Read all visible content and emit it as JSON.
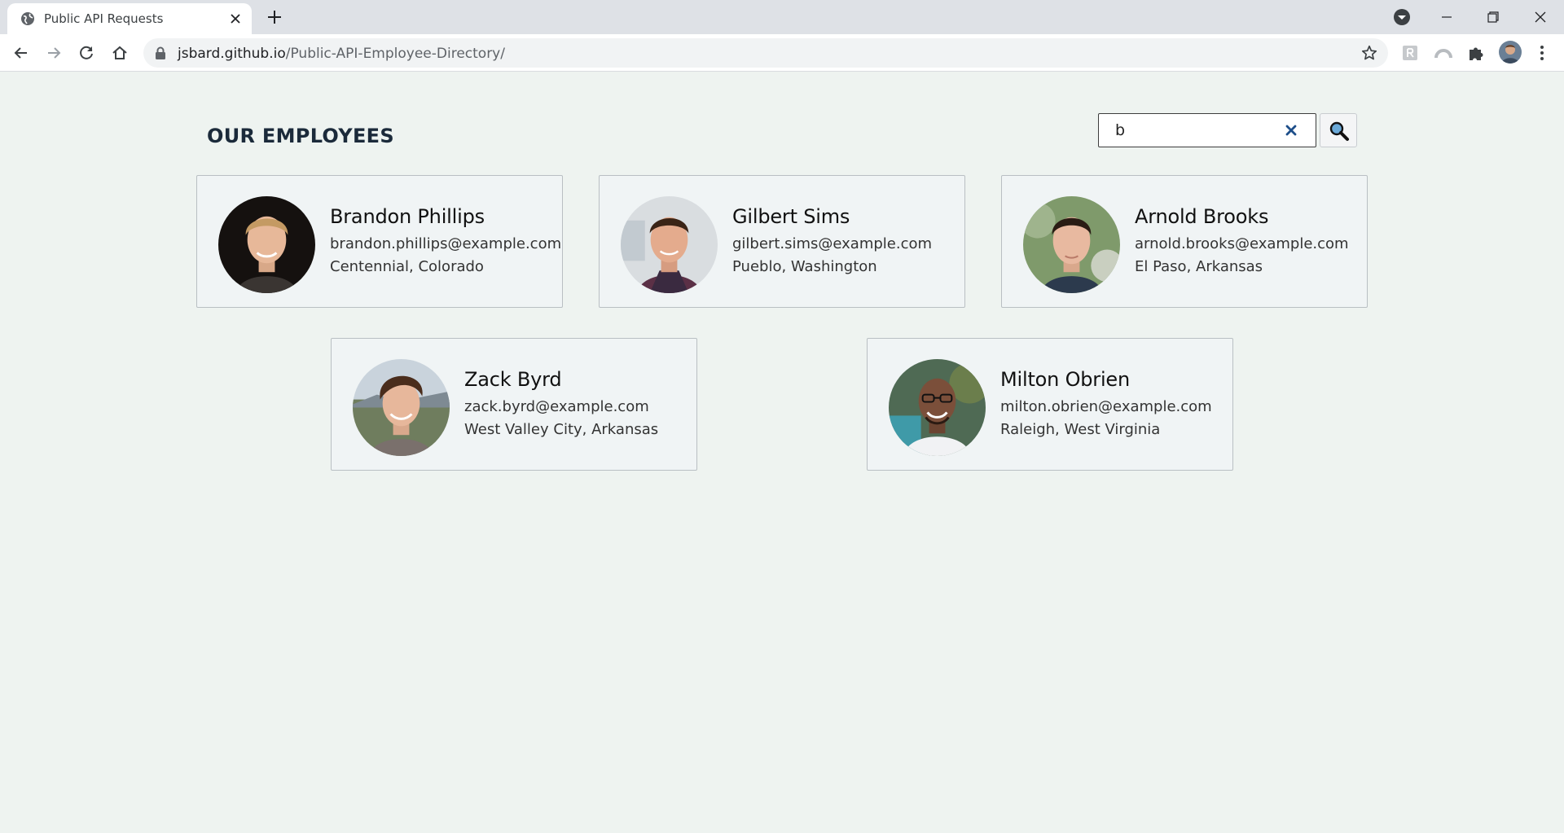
{
  "browser": {
    "tab_title": "Public API Requests",
    "url_host": "jsbard.github.io",
    "url_path": "/Public-API-Employee-Directory/"
  },
  "page": {
    "heading": "OUR EMPLOYEES",
    "search": {
      "value": "b"
    }
  },
  "employees": [
    {
      "name": "Brandon Phillips",
      "email": "brandon.phillips@example.com",
      "location": "Centennial, Colorado"
    },
    {
      "name": "Gilbert Sims",
      "email": "gilbert.sims@example.com",
      "location": "Pueblo, Washington"
    },
    {
      "name": "Arnold Brooks",
      "email": "arnold.brooks@example.com",
      "location": "El Paso, Arkansas"
    },
    {
      "name": "Zack Byrd",
      "email": "zack.byrd@example.com",
      "location": "West Valley City, Arkansas"
    },
    {
      "name": "Milton Obrien",
      "email": "milton.obrien@example.com",
      "location": "Raleigh, West Virginia"
    }
  ],
  "colors": {
    "page_background": "#eef3f0",
    "card_background": "#f0f4f5",
    "card_border": "#b9bfc3",
    "heading": "#1b2a3a",
    "clear_icon": "#1d4e89"
  },
  "icons": {
    "tab_favicon": "globe-icon",
    "search_clear": "close-x-icon",
    "search_submit": "magnifier-icon"
  }
}
